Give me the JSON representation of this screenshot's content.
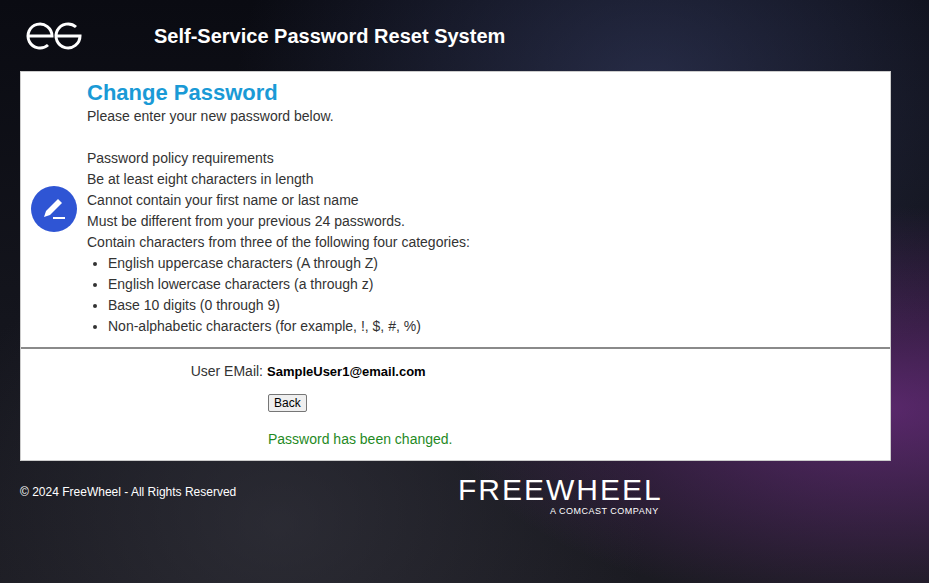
{
  "header": {
    "title": "Self-Service Password Reset System"
  },
  "panel": {
    "title": "Change Password",
    "subtitle": "Please enter your new password below.",
    "policy_heading": "Password policy requirements",
    "rules": [
      "Be at least eight characters in length",
      "Cannot contain your first name or last name",
      "Must be different from your previous 24 passwords.",
      "Contain characters from three of the following four categories:"
    ],
    "categories": [
      "English uppercase characters (A through Z)",
      "English lowercase characters (a through z)",
      "Base 10 digits (0 through 9)",
      "Non-alphabetic characters (for example, !, $, #, %)"
    ]
  },
  "form": {
    "email_label": "User EMail:",
    "email": "SampleUser1@email.com",
    "back_button": "Back",
    "message": "Password has been changed."
  },
  "footer": {
    "copyright": "© 2024 FreeWheel - All Rights Reserved",
    "brand": "FREEWHEEL",
    "brand_tagline": "A COMCAST COMPANY"
  }
}
